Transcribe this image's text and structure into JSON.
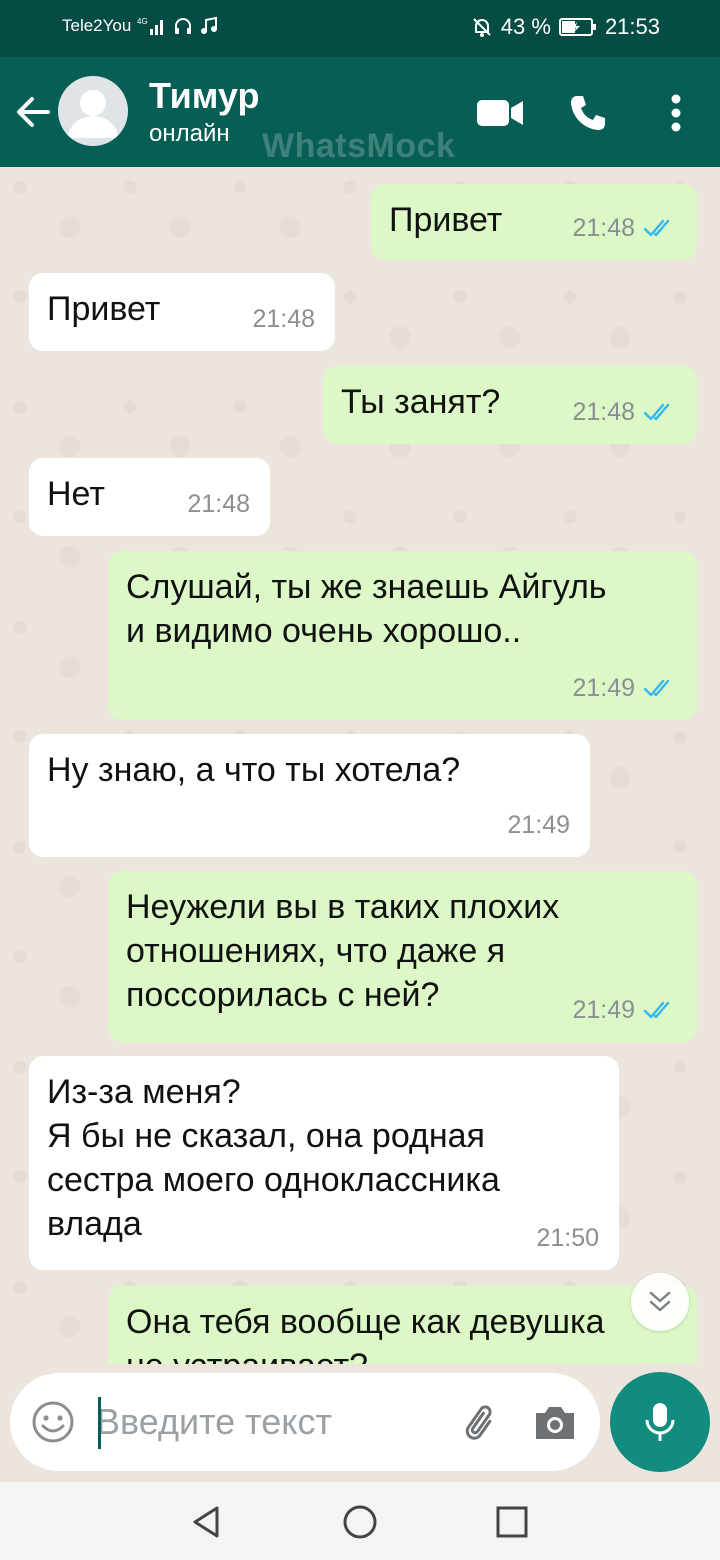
{
  "status_bar": {
    "carrier": "Tele2You",
    "network": "4G",
    "battery": "43 %",
    "time": "21:53"
  },
  "header": {
    "contact_name": "Тимур",
    "contact_status": "онлайн",
    "watermark": "WhatsMock"
  },
  "messages": [
    {
      "dir": "out",
      "text": "Привет",
      "time": "21:48",
      "read": true
    },
    {
      "dir": "in",
      "text": "Привет",
      "time": "21:48"
    },
    {
      "dir": "out",
      "text": "Ты занят?",
      "time": "21:48",
      "read": true
    },
    {
      "dir": "in",
      "text": "Нет",
      "time": "21:48"
    },
    {
      "dir": "out",
      "text": "Слушай, ты же знаешь Айгуль\nи видимо очень хорошо..",
      "time": "21:49",
      "read": true
    },
    {
      "dir": "in",
      "text": "Ну знаю, а что ты хотела?",
      "time": "21:49"
    },
    {
      "dir": "out",
      "text": "Неужели вы в таких плохих\nотношениях, что даже я\nпоссорилась с ней?",
      "time": "21:49",
      "read": true
    },
    {
      "dir": "in",
      "text": "Из-за меня?\nЯ бы не сказал, она родная\nсестра моего одноклассника\nвлада",
      "time": "21:50"
    },
    {
      "dir": "out",
      "text": "Она тебя вообще как девушка\nне устраивает?",
      "time": ""
    }
  ],
  "composer": {
    "placeholder": "Введите текст"
  },
  "colors": {
    "header": "#075e54",
    "status_bar": "#054d44",
    "outgoing_bubble": "#dcf8c6",
    "incoming_bubble": "#ffffff",
    "read_ticks": "#34b7f1",
    "mic_button": "#128c7e"
  }
}
